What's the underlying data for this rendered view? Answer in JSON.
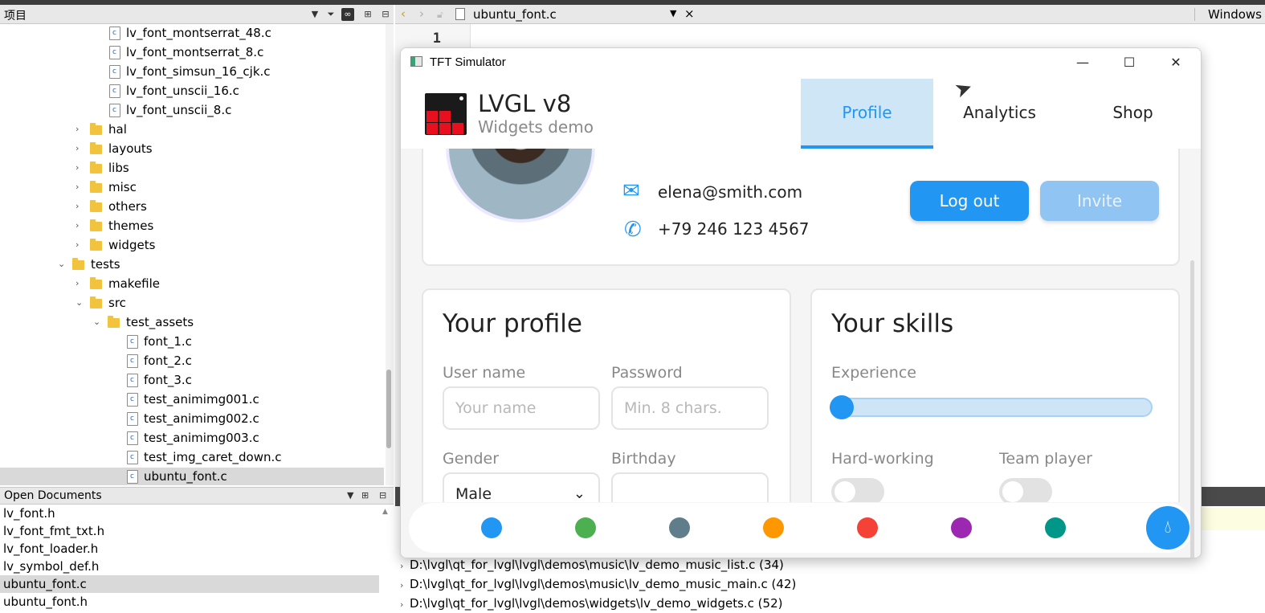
{
  "project_pane": {
    "title": "项目",
    "tree": [
      {
        "label": "lv_font_montserrat_48.c",
        "type": "file",
        "indent": 4
      },
      {
        "label": "lv_font_montserrat_8.c",
        "type": "file",
        "indent": 4
      },
      {
        "label": "lv_font_simsun_16_cjk.c",
        "type": "file",
        "indent": 4
      },
      {
        "label": "lv_font_unscii_16.c",
        "type": "file",
        "indent": 4
      },
      {
        "label": "lv_font_unscii_8.c",
        "type": "file",
        "indent": 4
      },
      {
        "label": "hal",
        "type": "folder",
        "indent": 3,
        "expanded": false
      },
      {
        "label": "layouts",
        "type": "folder",
        "indent": 3,
        "expanded": false
      },
      {
        "label": "libs",
        "type": "folder",
        "indent": 3,
        "expanded": false
      },
      {
        "label": "misc",
        "type": "folder",
        "indent": 3,
        "expanded": false
      },
      {
        "label": "others",
        "type": "folder",
        "indent": 3,
        "expanded": false
      },
      {
        "label": "themes",
        "type": "folder",
        "indent": 3,
        "expanded": false
      },
      {
        "label": "widgets",
        "type": "folder",
        "indent": 3,
        "expanded": false
      },
      {
        "label": "tests",
        "type": "folder",
        "indent": 2,
        "expanded": true
      },
      {
        "label": "makefile",
        "type": "folder",
        "indent": 3,
        "expanded": false
      },
      {
        "label": "src",
        "type": "folder",
        "indent": 3,
        "expanded": true
      },
      {
        "label": "test_assets",
        "type": "folder",
        "indent": 4,
        "expanded": true
      },
      {
        "label": "font_1.c",
        "type": "file",
        "indent": 5
      },
      {
        "label": "font_2.c",
        "type": "file",
        "indent": 5
      },
      {
        "label": "font_3.c",
        "type": "file",
        "indent": 5
      },
      {
        "label": "test_animimg001.c",
        "type": "file",
        "indent": 5
      },
      {
        "label": "test_animimg002.c",
        "type": "file",
        "indent": 5
      },
      {
        "label": "test_animimg003.c",
        "type": "file",
        "indent": 5
      },
      {
        "label": "test_img_caret_down.c",
        "type": "file",
        "indent": 5
      },
      {
        "label": "ubuntu_font.c",
        "type": "file",
        "indent": 5,
        "selected": true
      }
    ]
  },
  "open_documents": {
    "title": "Open Documents",
    "items": [
      {
        "label": "lv_font.h"
      },
      {
        "label": "lv_font_fmt_txt.h"
      },
      {
        "label": "lv_font_loader.h"
      },
      {
        "label": "lv_symbol_def.h"
      },
      {
        "label": "ubuntu_font.c",
        "selected": true
      },
      {
        "label": "ubuntu_font.h"
      }
    ]
  },
  "editor": {
    "file_name": "ubuntu_font.c",
    "right_label": "Windows",
    "line_number": "1"
  },
  "search_results": [
    "D:\\lvgl\\qt_for_lvgl\\lvgl\\demos\\music\\lv_demo_music_list.c (34)",
    "D:\\lvgl\\qt_for_lvgl\\lvgl\\demos\\music\\lv_demo_music_main.c (42)",
    "D:\\lvgl\\qt_for_lvgl\\lvgl\\demos\\widgets\\lv_demo_widgets.c (52)"
  ],
  "simulator": {
    "window_title": "TFT Simulator",
    "brand_title": "LVGL v8",
    "brand_subtitle": "Widgets demo",
    "tabs": [
      {
        "label": "Profile",
        "active": true
      },
      {
        "label": "Analytics",
        "active": false
      },
      {
        "label": "Shop",
        "active": false
      }
    ],
    "email": "elena@smith.com",
    "phone": "+79 246 123 4567",
    "logout_label": "Log out",
    "invite_label": "Invite",
    "profile_card": {
      "title": "Your profile",
      "username_label": "User name",
      "username_placeholder": "Your name",
      "password_label": "Password",
      "password_placeholder": "Min. 8 chars.",
      "gender_label": "Gender",
      "gender_value": "Male",
      "birthday_label": "Birthday"
    },
    "skills_card": {
      "title": "Your skills",
      "experience_label": "Experience",
      "experience_value": 0,
      "hardworking_label": "Hard-working",
      "hardworking_on": false,
      "teamplayer_label": "Team player",
      "teamplayer_on": false
    },
    "palette": [
      "#2196f3",
      "#4caf50",
      "#607d8b",
      "#ff9800",
      "#f44336",
      "#9c27b0",
      "#009688"
    ],
    "accent": "#2196f3"
  }
}
